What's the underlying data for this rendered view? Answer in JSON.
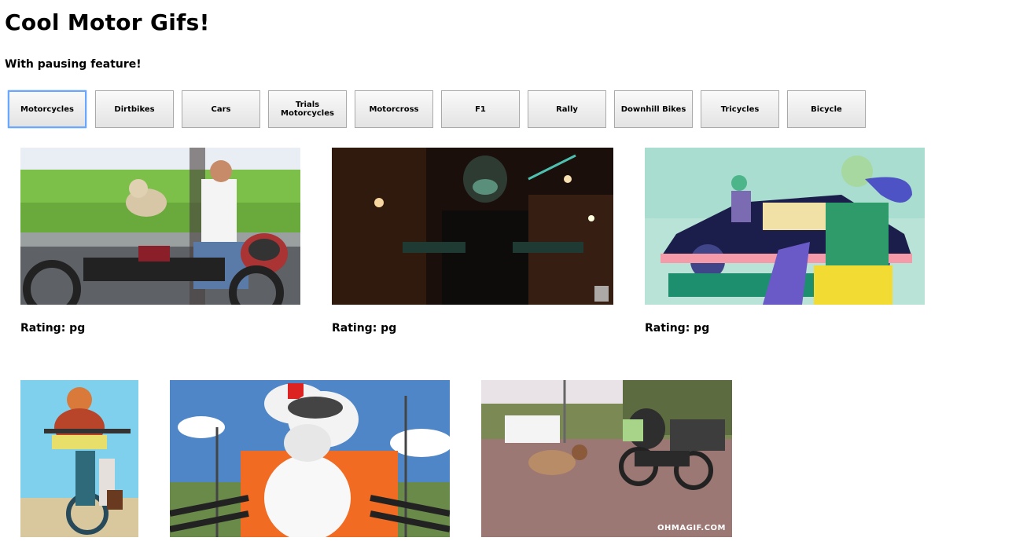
{
  "page": {
    "title": "Cool Motor Gifs!",
    "subtitle": "With pausing feature!"
  },
  "categories": [
    {
      "label": "Motorcycles",
      "active": true
    },
    {
      "label": "Dirtbikes",
      "active": false
    },
    {
      "label": "Cars",
      "active": false
    },
    {
      "label": "Trials Motorcycles",
      "active": false
    },
    {
      "label": "Motorcross",
      "active": false
    },
    {
      "label": "F1",
      "active": false
    },
    {
      "label": "Rally",
      "active": false
    },
    {
      "label": "Downhill Bikes",
      "active": false
    },
    {
      "label": "Tricycles",
      "active": false
    },
    {
      "label": "Bicycle",
      "active": false
    }
  ],
  "gifs": [
    {
      "rating": "Rating: pg",
      "subject": "man riding motorcycle with dog"
    },
    {
      "rating": "Rating: pg",
      "subject": "night motorcycle ride"
    },
    {
      "rating": "Rating: pg",
      "subject": "illustrated rider and car"
    },
    {
      "subject": "wrestler on dirt bike"
    },
    {
      "subject": "dog with goggles on motorcycle"
    },
    {
      "subject": "sheep crossing road near motorcycle",
      "watermark": "OHMAGIF.COM"
    }
  ]
}
